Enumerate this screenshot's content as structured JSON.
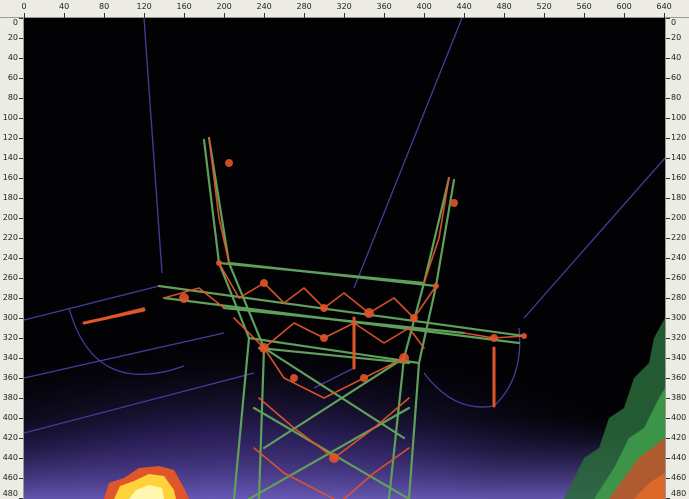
{
  "viewer": {
    "mode": "thermal-image",
    "palette_colors": {
      "background": "#020205",
      "cool_tint": "#3a2370",
      "mid": "#5fa05a",
      "warm": "#e0552a",
      "hot": "#ffd23a",
      "hottest": "#fff6b0"
    }
  },
  "rulers": {
    "top": {
      "start": 0,
      "end": 640,
      "step": 40,
      "labels": [
        "0",
        "40",
        "80",
        "120",
        "160",
        "200",
        "240",
        "280",
        "320",
        "360",
        "400",
        "440",
        "480",
        "520",
        "560",
        "600",
        "640"
      ]
    },
    "side": {
      "start": 0,
      "end": 480,
      "step": 20,
      "labels": [
        "0",
        "20",
        "40",
        "60",
        "80",
        "100",
        "120",
        "140",
        "160",
        "180",
        "200",
        "220",
        "240",
        "260",
        "280",
        "300",
        "320",
        "340",
        "360",
        "380",
        "400",
        "420",
        "440",
        "460",
        "480"
      ]
    }
  }
}
